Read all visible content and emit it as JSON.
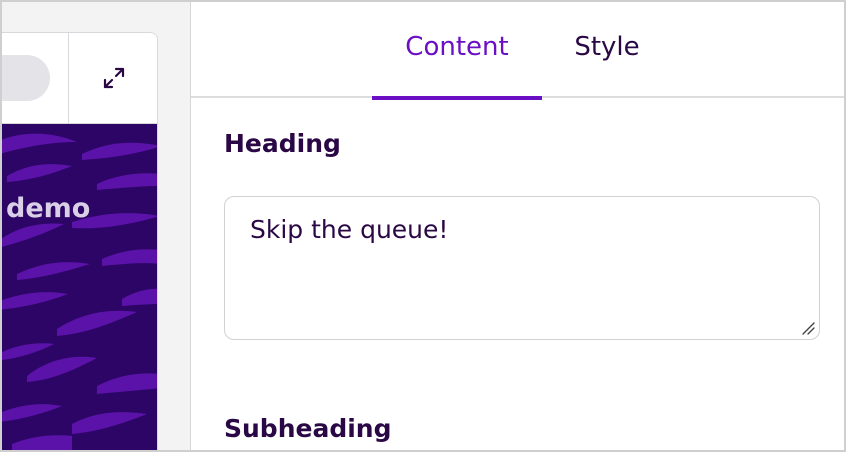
{
  "preview": {
    "banner_text": "demo",
    "banner_color": "#2c0566",
    "pattern_color": "#5b12a8",
    "expand_icon": "expand-arrows-icon"
  },
  "editor": {
    "tabs": [
      {
        "label": "Content",
        "active": true
      },
      {
        "label": "Style",
        "active": false
      }
    ],
    "accent_color": "#6a0fc4",
    "text_color": "#2a0845",
    "fields": {
      "heading": {
        "label": "Heading",
        "value": "Skip the queue!"
      },
      "subheading": {
        "label": "Subheading"
      }
    }
  }
}
